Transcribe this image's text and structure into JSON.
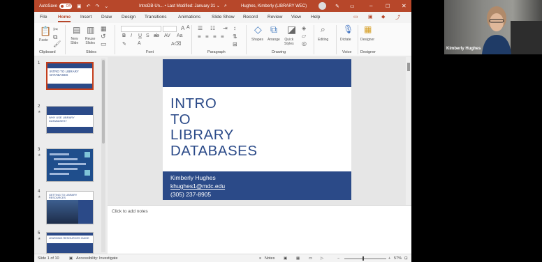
{
  "titlebar": {
    "autosave_label": "AutoSave",
    "autosave_state": "Off",
    "doc_title": "IntroDB-Un...  •  Last Modified: January 31  ⌄",
    "user_name": "Hughes, Kimberly (LIBRARY WEC)"
  },
  "menu": {
    "tabs": [
      "File",
      "Home",
      "Insert",
      "Draw",
      "Design",
      "Transitions",
      "Animations",
      "Slide Show",
      "Record",
      "Review",
      "View",
      "Help"
    ],
    "active_tab": "Home"
  },
  "ribbon": {
    "groups": [
      "Clipboard",
      "Slides",
      "Font",
      "Paragraph",
      "Drawing",
      "Voice",
      "Designer"
    ],
    "paste_label": "Paste",
    "new_slide_label": "New\nSlide",
    "reuse_slides_label": "Reuse\nSlides",
    "shapes_label": "Shapes",
    "arrange_label": "Arrange",
    "quick_styles_label": "Quick\nStyles",
    "editing_label": "Editing",
    "dictate_label": "Dictate",
    "designer_label": "Designer"
  },
  "thumbnails": [
    {
      "number": "1",
      "title": "INTRO TO LIBRARY DATABASES"
    },
    {
      "number": "2",
      "title": "WHY USE LIBRARY DATABASES?"
    },
    {
      "number": "3",
      "title": ""
    },
    {
      "number": "4",
      "title": "GETTING TO LIBRARY RESOURCES"
    },
    {
      "number": "5",
      "title": "LEARNING RESOURCES GUIDE"
    }
  ],
  "slide": {
    "title": "INTRO\nTO\nLIBRARY\nDATABASES",
    "name": "Kimberly Hughes",
    "email": "khughes1@mdc.edu",
    "phone": "(305) 237-8905"
  },
  "notes_placeholder": "Click to add notes",
  "status": {
    "slide_counter": "Slide 1 of 10",
    "accessibility": "Accessibility: Investigate",
    "notes_label": "Notes",
    "zoom": "57%"
  },
  "webcam": {
    "participant_name": "Kimberly Hughes"
  },
  "colors": {
    "accent": "#b7472a",
    "slide_blue": "#2b4a88"
  }
}
